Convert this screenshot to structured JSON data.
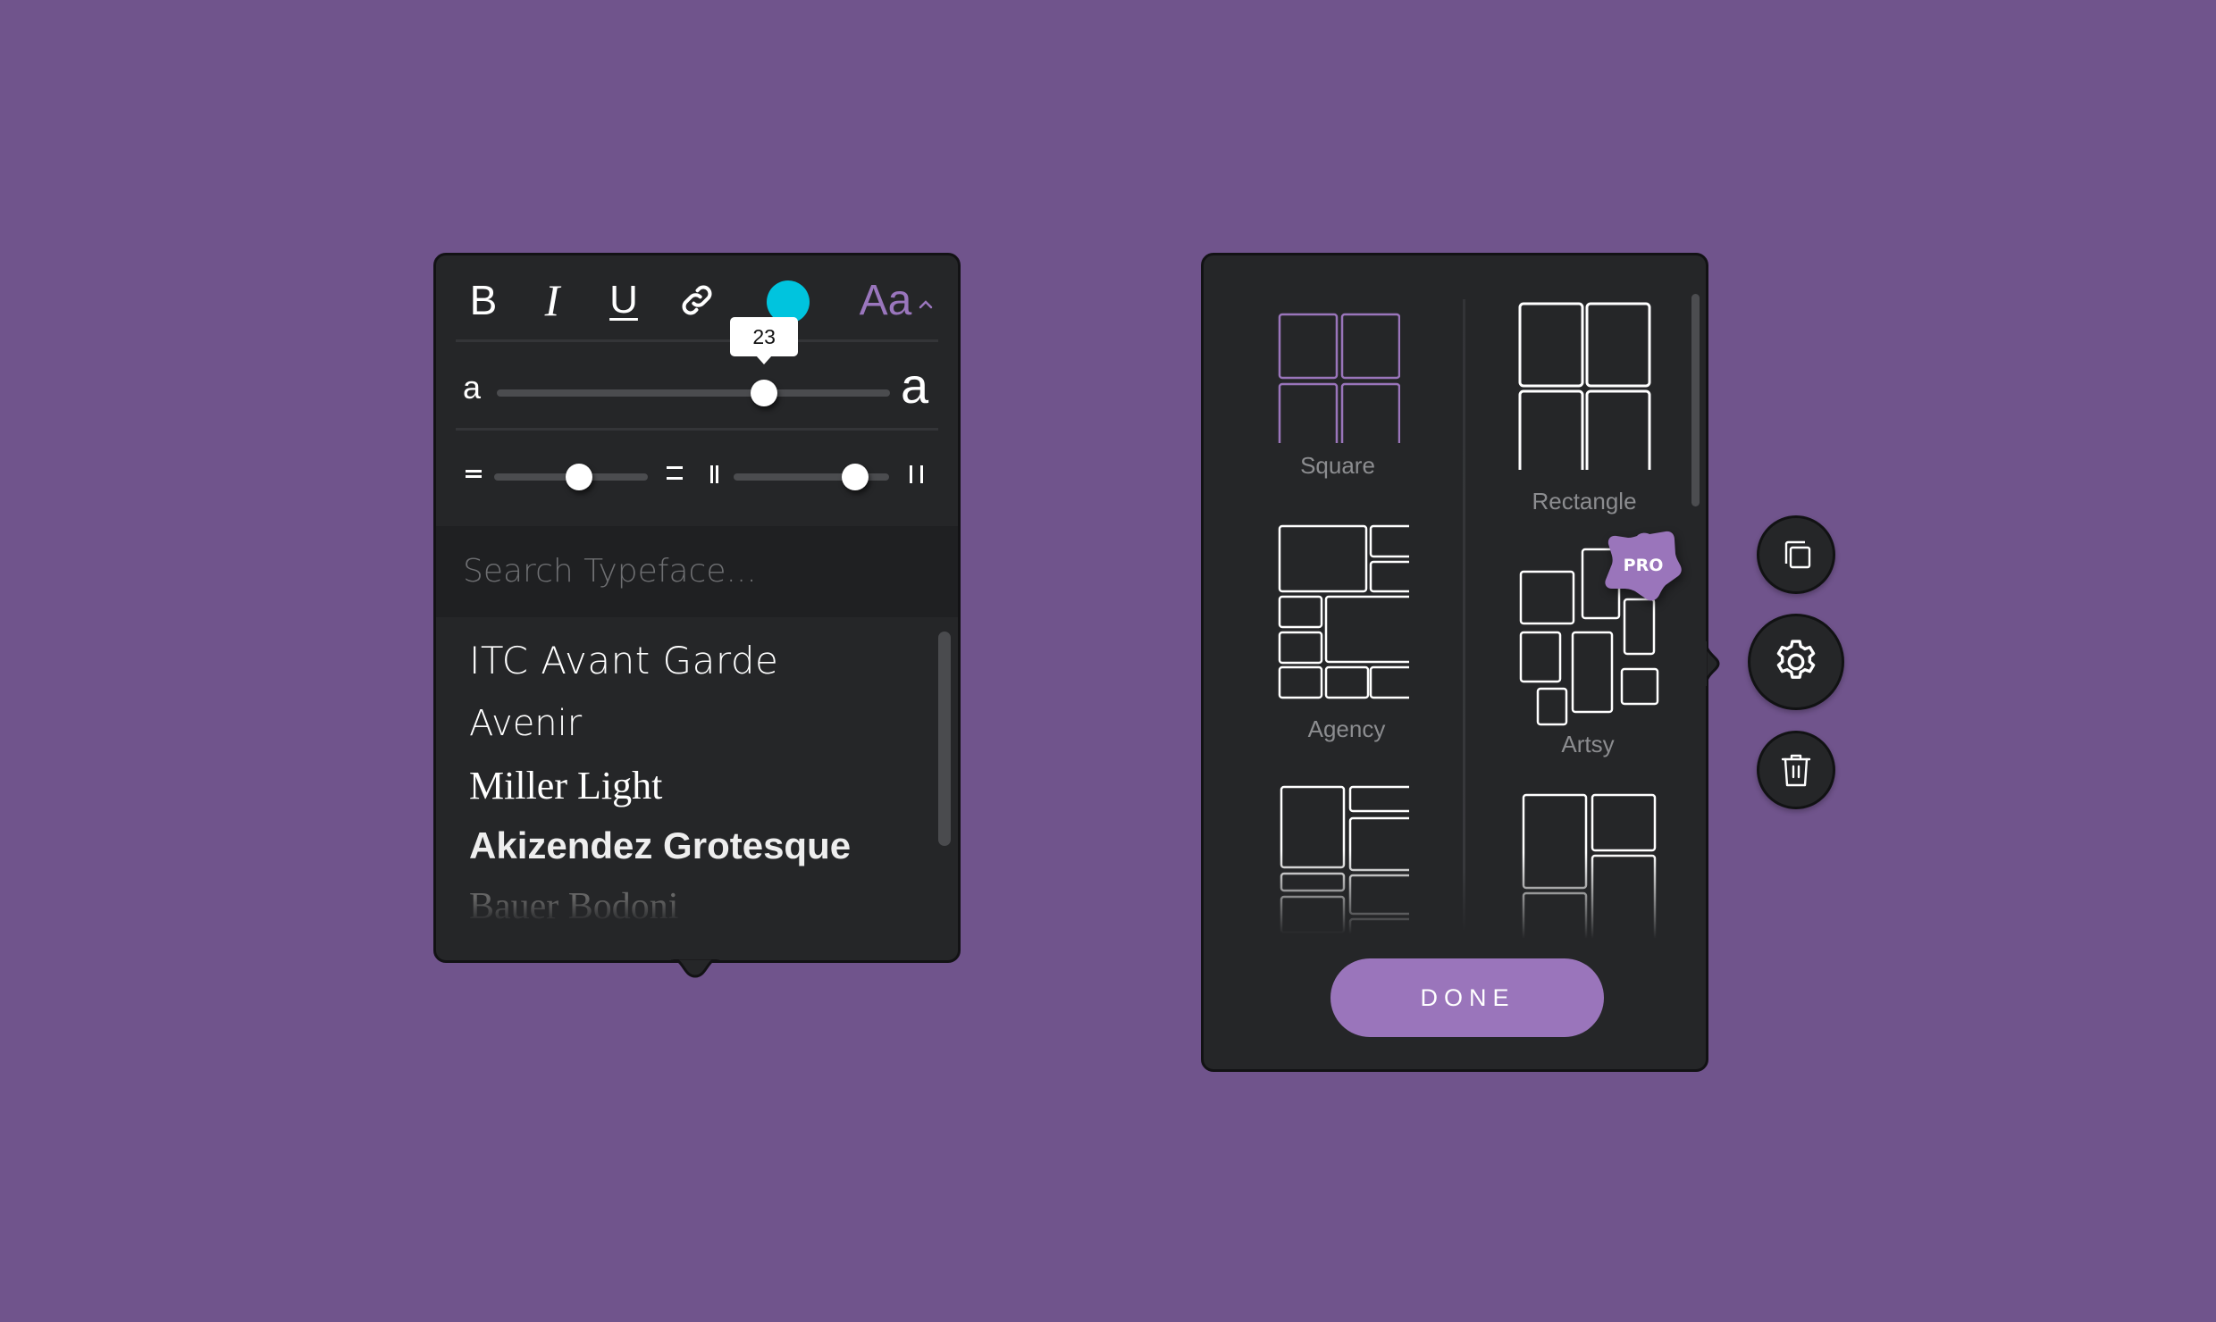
{
  "text_panel": {
    "toolbar": {
      "bold_label": "B",
      "italic_label": "I",
      "underline_label": "U",
      "link_icon": "link-icon",
      "text_color": "#00c4de",
      "font_menu_label": "Aa",
      "font_menu_caret": "^"
    },
    "font_size": {
      "min_label": "a",
      "max_label": "a",
      "value": "23",
      "position_percent": 68
    },
    "line_height": {
      "min_icon": "line-height-tight-icon",
      "max_icon": "line-height-loose-icon",
      "position_percent": 55
    },
    "letter_spacing": {
      "min_icon": "letter-spacing-tight-icon",
      "max_icon": "letter-spacing-loose-icon",
      "position_percent": 78
    },
    "search": {
      "placeholder": "Search Typeface...",
      "value": ""
    },
    "fonts": [
      "ITC Avant Garde",
      "Avenir",
      "Miller Light",
      "Akizendez Grotesque",
      "Bauer Bodoni"
    ]
  },
  "layout_panel": {
    "layouts": [
      {
        "label": "Square",
        "selected": true,
        "pro": false
      },
      {
        "label": "Rectangle",
        "selected": false,
        "pro": false
      },
      {
        "label": "Agency",
        "selected": false,
        "pro": false
      },
      {
        "label": "Artsy",
        "selected": false,
        "pro": true
      }
    ],
    "pro_badge_label": "PRO",
    "done_label": "DONE",
    "accent_color": "#9a75bb"
  },
  "side_actions": [
    {
      "name": "duplicate",
      "icon": "copy-icon"
    },
    {
      "name": "settings",
      "icon": "gear-icon"
    },
    {
      "name": "delete",
      "icon": "trash-icon"
    }
  ],
  "colors": {
    "background": "#70548c",
    "panel": "#252628",
    "accent": "#9a75bb"
  }
}
